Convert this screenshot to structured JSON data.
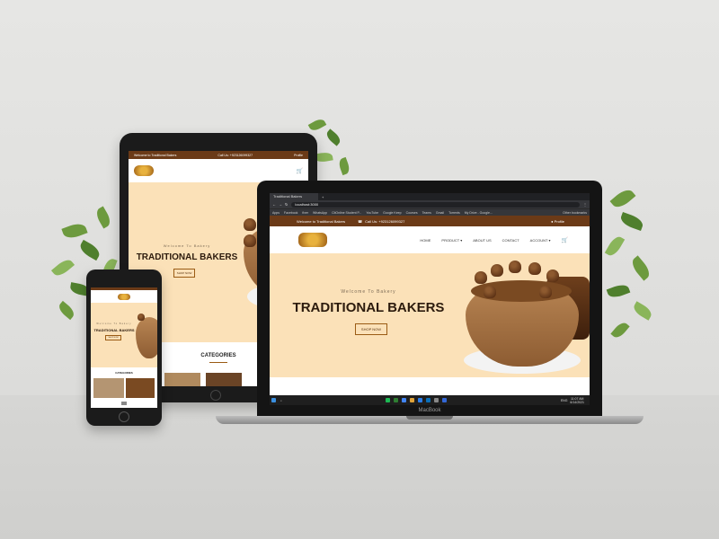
{
  "site": {
    "topbar_welcome": "Welcome to Traditional Bakers",
    "topbar_phone": "Call Us: +923126099327",
    "topbar_profile": "Profile",
    "hero_welcome": "Welcome To Bakery",
    "hero_title": "TRADITIONAL BAKERS",
    "shop_button": "SHOP NOW",
    "categories_heading": "CATEGORIES",
    "nav": [
      {
        "label": "HOME"
      },
      {
        "label": "PRODUCT"
      },
      {
        "label": "ABOUT US"
      },
      {
        "label": "CONTACT"
      },
      {
        "label": "ACCOUNT"
      }
    ]
  },
  "browser": {
    "tab_title": "Traditional Bakers",
    "new_tab": "+",
    "url": "localhost:3000",
    "bookmarks": [
      "Apps",
      "Facebook",
      "fiver",
      "WhatsApp",
      "CitOnline Student P...",
      "YouTube",
      "Google Keep",
      "Courses",
      "Teams",
      "Gmail",
      "Torrents",
      "My Drive - Google..."
    ],
    "other_bookmarks": "Other bookmarks"
  },
  "taskbar": {
    "time": "11:07 AM",
    "date": "6/14/2021",
    "lang": "ENG"
  },
  "device": {
    "laptop_brand": "MacBook"
  },
  "colors": {
    "brown": "#6b3a17",
    "hero_bg": "#fbe1b8",
    "title": "#2c1b0d",
    "accent": "#9a5b14"
  }
}
